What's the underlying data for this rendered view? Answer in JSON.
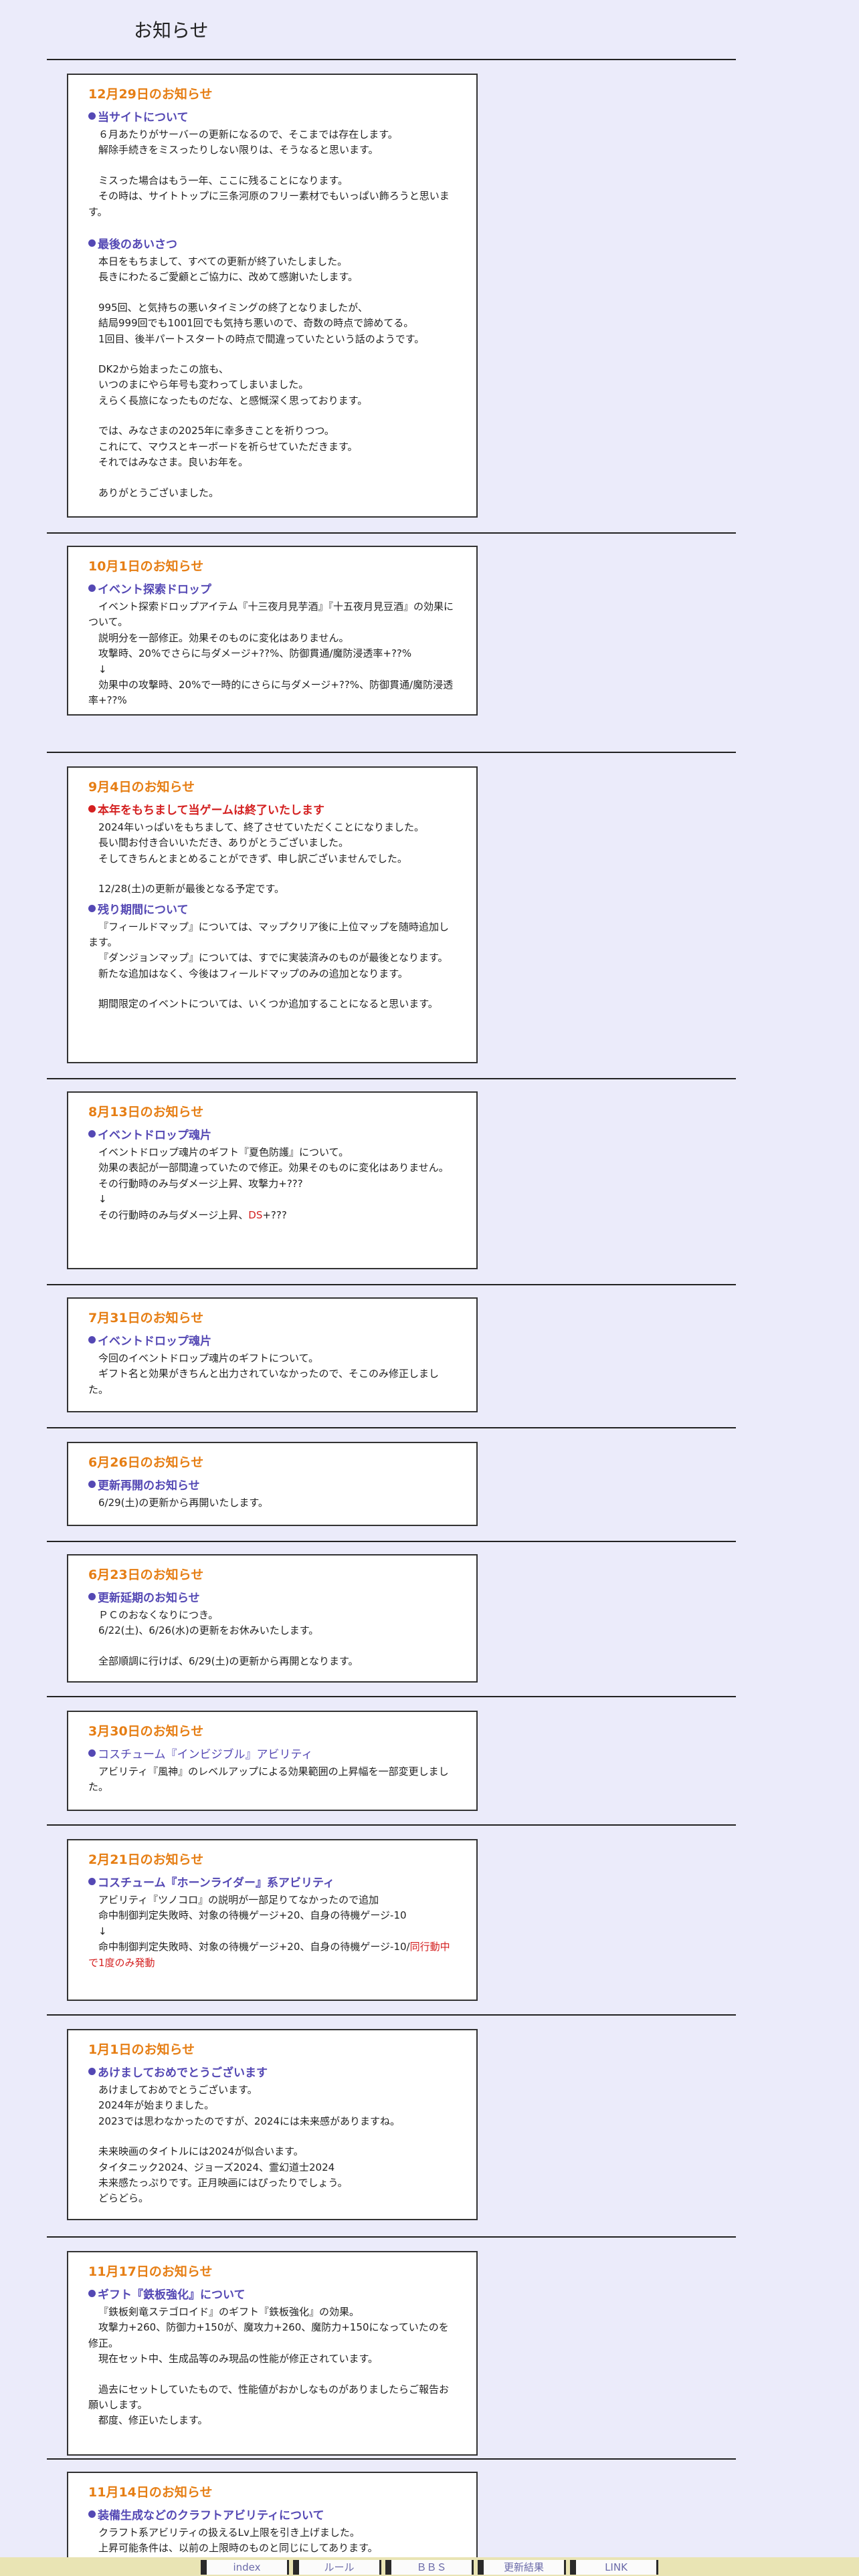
{
  "page_title": "お知らせ",
  "news": [
    {
      "date": "12月29日のお知らせ",
      "sections": [
        {
          "heading": "当サイトについて",
          "paras": [
            [
              "６月あたりがサーバーの更新になるので、そこまでは存在します。",
              "解除手続きをミスったりしない限りは、そうなると思います。"
            ],
            [
              "ミスった場合はもう一年、ここに残ることになります。",
              "その時は、サイトトップに三条河原のフリー素材でもいっぱい飾ろうと思います。"
            ]
          ]
        },
        {
          "heading": "最後のあいさつ",
          "paras": [
            [
              "本日をもちまして、すべての更新が終了いたしました。",
              "長きにわたるご愛顧とご協力に、改めて感謝いたします。"
            ],
            [
              "995回、と気持ちの悪いタイミングの終了となりましたが、",
              "結局999回でも1001回でも気持ち悪いので、奇数の時点で諦めてる。",
              "1回目、後半パートスタートの時点で間違っていたという話のようです。"
            ],
            [
              "DK2から始まったこの旅も、",
              "いつのまにやら年号も変わってしまいました。",
              "えらく長旅になったものだな、と感慨深く思っております。"
            ],
            [
              "では、みなさまの2025年に幸多きことを祈りつつ。",
              "これにて、マウスとキーボードを祈らせていただきます。",
              "それではみなさま。良いお年を。"
            ],
            [
              "ありがとうございました。"
            ]
          ]
        }
      ]
    },
    {
      "date": "10月1日のお知らせ",
      "sections": [
        {
          "heading": "イベント探索ドロップ",
          "paras": [
            [
              "イベント探索ドロップアイテム『十三夜月見芋酒』『十五夜月見豆酒』の効果について。",
              "説明分を一部修正。効果そのものに変化はありません。",
              "攻撃時、20%でさらに与ダメージ+??%、防御貫通/魔防浸透率+??%",
              "↓",
              "効果中の攻撃時、20%で一時的にさらに与ダメージ+??%、防御貫通/魔防浸透率+??%"
            ]
          ]
        }
      ]
    },
    {
      "date": "9月4日のお知らせ",
      "sections": [
        {
          "heading": "本年をもちまして当ゲームは終了いたします",
          "red": true,
          "paras": [
            [
              "2024年いっぱいをもちまして、終了させていただくことになりました。",
              "長い間お付き合いいただき、ありがとうございました。",
              "そしてきちんとまとめることができず、申し訳ございませんでした。"
            ],
            [
              "12/28(土)の更新が最後となる予定です。"
            ]
          ]
        },
        {
          "heading": "残り期間について",
          "paras": [
            [
              "『フィールドマップ』については、マップクリア後に上位マップを随時追加します。",
              "『ダンジョンマップ』については、すでに実装済みのものが最後となります。",
              "新たな追加はなく、今後はフィールドマップのみの追加となります。"
            ],
            [
              "期間限定のイベントについては、いくつか追加することになると思います。"
            ]
          ]
        }
      ]
    },
    {
      "date": "8月13日のお知らせ",
      "sections": [
        {
          "heading": "イベントドロップ魂片",
          "paras": [
            [
              "イベントドロップ魂片のギフト『夏色防護』について。",
              "効果の表記が一部間違っていたので修正。効果そのものに変化はありません。",
              "その行動時のみ与ダメージ上昇、攻撃力+???",
              "↓",
              "その行動時のみ与ダメージ上昇、DS+???"
            ]
          ]
        }
      ]
    },
    {
      "date": "7月31日のお知らせ",
      "sections": [
        {
          "heading": "イベントドロップ魂片",
          "paras": [
            [
              "今回のイベントドロップ魂片のギフトについて。",
              "ギフト名と効果がきちんと出力されていなかったので、そこのみ修正しました。"
            ]
          ]
        }
      ]
    },
    {
      "date": "6月26日のお知らせ",
      "sections": [
        {
          "heading": "更新再開のお知らせ",
          "paras": [
            [
              "6/29(土)の更新から再開いたします。"
            ]
          ]
        }
      ]
    },
    {
      "date": "6月23日のお知らせ",
      "sections": [
        {
          "heading": "更新延期のお知らせ",
          "paras": [
            [
              "ＰＣのおなくなりにつき。",
              "6/22(土)、6/26(水)の更新をお休みいたします。"
            ],
            [
              "全部順調に行けば、6/29(土)の更新から再開となります。"
            ]
          ]
        }
      ]
    },
    {
      "date": "3月30日のお知らせ",
      "sections": [
        {
          "heading": "コスチューム『インビジブル』アビリティ",
          "paras": [
            [
              "アビリティ『風神』のレベルアップによる効果範囲の上昇幅を一部変更しました。"
            ]
          ]
        }
      ]
    },
    {
      "date": "2月21日のお知らせ",
      "sections": [
        {
          "heading": "コスチューム『ホーンライダー』系アビリティ",
          "paras": [
            [
              "アビリティ『ツノコロ』の説明が一部足りてなかったので追加",
              "命中制御判定失敗時、対象の待機ゲージ+20、自身の待機ゲージ-10",
              "↓",
              "命中制御判定失敗時、対象の待機ゲージ+20、自身の待機ゲージ-10/同行動中で1度のみ発動"
            ]
          ]
        }
      ]
    },
    {
      "date": "1月1日のお知らせ",
      "sections": [
        {
          "heading": "あけましておめでとうございます",
          "paras": [
            [
              "あけましておめでとうございます。",
              "2024年が始まりました。",
              "2023では思わなかったのですが、2024には未来感がありますね。"
            ],
            [
              "未来映画のタイトルには2024が似合います。",
              "タイタニック2024、ジョーズ2024、霊幻道士2024",
              "未来感たっぷりです。正月映画にはぴったりでしょう。",
              "どらどら。"
            ]
          ]
        }
      ]
    },
    {
      "date": "11月17日のお知らせ",
      "sections": [
        {
          "heading": "ギフト『鉄板強化』について",
          "paras": [
            [
              "『鉄板剣竜ステゴロイド』のギフト『鉄板強化』の効果。",
              "攻撃力+260、防御力+150が、魔攻力+260、魔防力+150になっていたのを修正。",
              "現在セット中、生成品等のみ現品の性能が修正されています。"
            ],
            [
              "過去にセットしていたもので、性能値がおかしなものがありましたらご報告お願いします。",
              "都度、修正いたします。"
            ]
          ]
        }
      ]
    },
    {
      "date": "11月14日のお知らせ",
      "sections": [
        {
          "heading": "装備生成などのクラフトアビリティについて",
          "paras": [
            [
              "クラフト系アビリティの扱えるLv上限を引き上げました。",
              "上昇可能条件は、以前の上限時のものと同じにしてあります。"
            ]
          ]
        }
      ]
    }
  ],
  "nav": [
    "index",
    "ルール",
    "ＢＢＳ",
    "更新結果",
    "LINK"
  ]
}
